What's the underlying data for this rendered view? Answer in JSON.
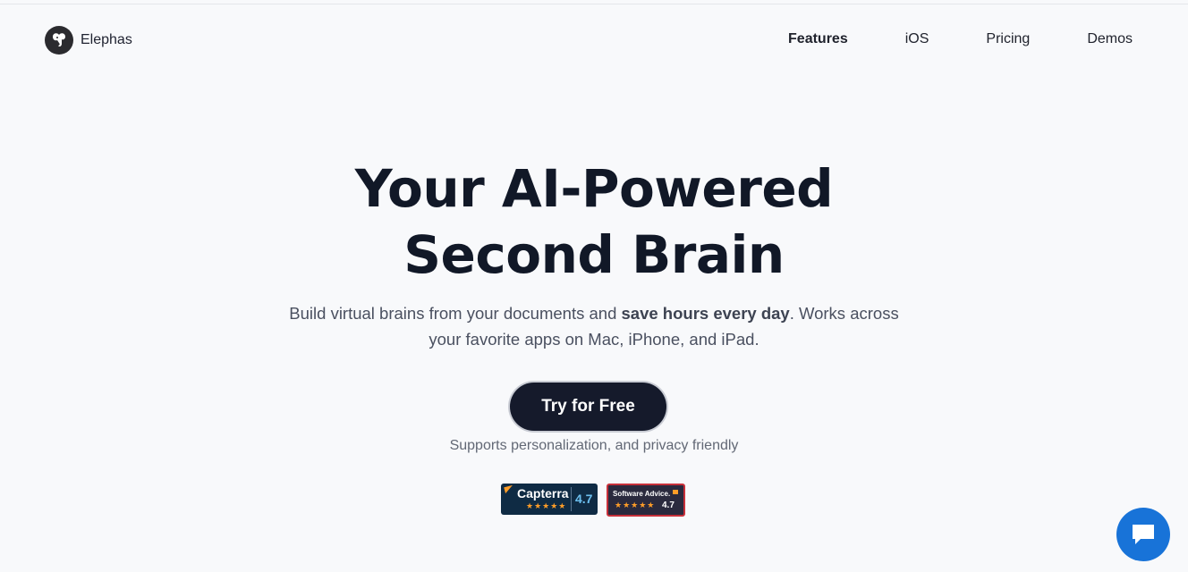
{
  "header": {
    "brand": "Elephas",
    "logo_icon": "elephant-icon",
    "nav": [
      {
        "label": "Features",
        "active": true
      },
      {
        "label": "iOS",
        "active": false
      },
      {
        "label": "Pricing",
        "active": false
      },
      {
        "label": "Demos",
        "active": false
      }
    ]
  },
  "hero": {
    "title_line1": "Your AI-Powered",
    "title_line2": "Second Brain",
    "subtitle_part1": "Build virtual brains from your documents and ",
    "subtitle_bold": "save hours every day",
    "subtitle_part2": ". Works across your favorite apps on Mac, iPhone, and iPad.",
    "cta_label": "Try for Free",
    "note": "Supports personalization, and privacy friendly"
  },
  "badges": {
    "capterra": {
      "name": "Capterra",
      "stars": "★★★★★",
      "score": "4.7"
    },
    "software_advice": {
      "name": "Software Advice.",
      "stars": "★★★★★",
      "score": "4.7"
    }
  },
  "chat": {
    "icon": "chat-bubble-icon"
  },
  "colors": {
    "background": "#f8f9fb",
    "cta": "#151a2b",
    "chat": "#1873d8"
  }
}
